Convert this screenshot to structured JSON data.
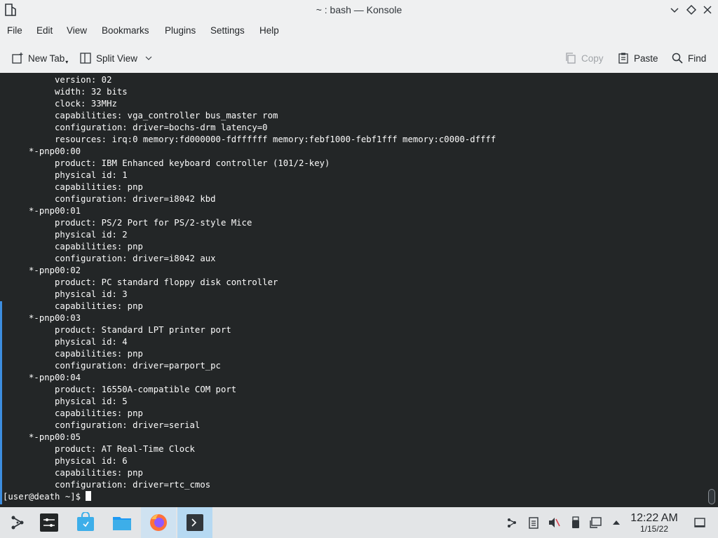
{
  "window": {
    "title": "~ : bash — Konsole",
    "menu": [
      "File",
      "Edit",
      "View",
      "Bookmarks",
      "Plugins",
      "Settings",
      "Help"
    ],
    "toolbar": {
      "new_tab": "New Tab",
      "split_view": "Split View",
      "copy": "Copy",
      "paste": "Paste",
      "find": "Find"
    }
  },
  "terminal": {
    "lines": [
      "          version: 02",
      "          width: 32 bits",
      "          clock: 33MHz",
      "          capabilities: vga_controller bus_master rom",
      "          configuration: driver=bochs-drm latency=0",
      "          resources: irq:0 memory:fd000000-fdffffff memory:febf1000-febf1fff memory:c0000-dffff",
      "     *-pnp00:00",
      "          product: IBM Enhanced keyboard controller (101/2-key)",
      "          physical id: 1",
      "          capabilities: pnp",
      "          configuration: driver=i8042 kbd",
      "     *-pnp00:01",
      "          product: PS/2 Port for PS/2-style Mice",
      "          physical id: 2",
      "          capabilities: pnp",
      "          configuration: driver=i8042 aux",
      "     *-pnp00:02",
      "          product: PC standard floppy disk controller",
      "          physical id: 3",
      "          capabilities: pnp",
      "     *-pnp00:03",
      "          product: Standard LPT printer port",
      "          physical id: 4",
      "          capabilities: pnp",
      "          configuration: driver=parport_pc",
      "     *-pnp00:04",
      "          product: 16550A-compatible COM port",
      "          physical id: 5",
      "          capabilities: pnp",
      "          configuration: driver=serial",
      "     *-pnp00:05",
      "          product: AT Real-Time Clock",
      "          physical id: 6",
      "          capabilities: pnp",
      "          configuration: driver=rtc_cmos"
    ],
    "prompt": "[user@death ~]$ "
  },
  "taskbar": {
    "clock_time": "12:22 AM",
    "clock_date": "1/15/22"
  },
  "colors": {
    "terminal_bg": "#232627",
    "terminal_fg": "#fcfcfc",
    "accent": "#3d8ee0"
  }
}
